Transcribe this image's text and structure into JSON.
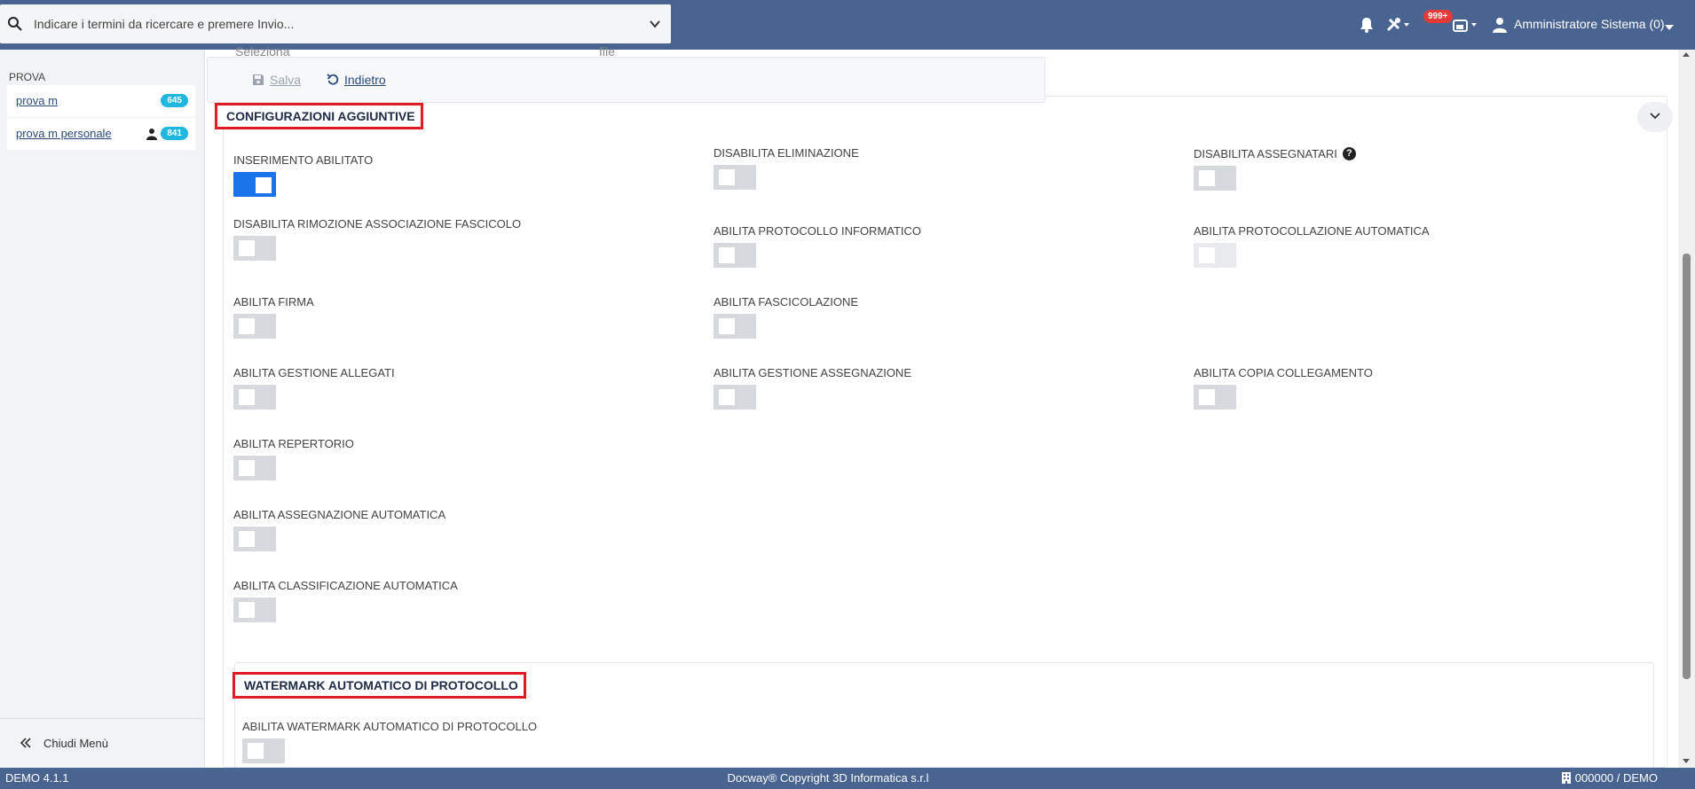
{
  "header": {
    "search_placeholder": "Indicare i termini da ricercare e premere Invio...",
    "notification_badge": "999+",
    "user_name": "Amministratore Sistema (0)"
  },
  "sidebar": {
    "section_title": "PROVA",
    "items": [
      {
        "label": "prova m",
        "count": "645"
      },
      {
        "label": "prova m personale",
        "count": "841"
      }
    ],
    "close_label": "Chiudi Menù"
  },
  "main": {
    "ghost_select_1": "Seleziona",
    "ghost_select_2": "file",
    "toolbar": {
      "save_label": "Salva",
      "back_label": "Indietro"
    },
    "section_title": "CONFIGURAZIONI AGGIUNTIVE",
    "fields": {
      "inserimento_abilitato": {
        "label": "INSERIMENTO ABILITATO",
        "on": true
      },
      "disabilita_eliminazione": {
        "label": "DISABILITA ELIMINAZIONE",
        "on": false
      },
      "disabilita_assegnatari": {
        "label": "DISABILITA ASSEGNATARI",
        "on": false
      },
      "disabilita_rimozione": {
        "label": "DISABILITA RIMOZIONE ASSOCIAZIONE FASCICOLO",
        "on": false
      },
      "abilita_protocollo_informatico": {
        "label": "ABILITA PROTOCOLLO INFORMATICO",
        "on": false
      },
      "abilita_protocollazione_automatica": {
        "label": "ABILITA PROTOCOLLAZIONE AUTOMATICA",
        "on": false,
        "disabled": true
      },
      "abilita_firma": {
        "label": "ABILITA FIRMA",
        "on": false
      },
      "abilita_fascicolazione": {
        "label": "ABILITA FASCICOLAZIONE",
        "on": false
      },
      "abilita_gestione_allegati": {
        "label": "ABILITA GESTIONE ALLEGATI",
        "on": false
      },
      "abilita_gestione_assegnazione": {
        "label": "ABILITA GESTIONE ASSEGNAZIONE",
        "on": false
      },
      "abilita_copia_collegamento": {
        "label": "ABILITA COPIA COLLEGAMENTO",
        "on": false
      },
      "abilita_repertorio": {
        "label": "ABILITA REPERTORIO",
        "on": false
      },
      "abilita_assegnazione_automatica": {
        "label": "ABILITA ASSEGNAZIONE AUTOMATICA",
        "on": false
      },
      "abilita_classificazione_automatica": {
        "label": "ABILITA CLASSIFICAZIONE AUTOMATICA",
        "on": false
      }
    },
    "watermark": {
      "title": "WATERMARK AUTOMATICO DI PROTOCOLLO",
      "field_label": "ABILITA WATERMARK AUTOMATICO DI PROTOCOLLO",
      "on": false
    }
  },
  "footer": {
    "version": "DEMO 4.1.1",
    "copyright": "Docway® Copyright 3D Informatica s.r.l",
    "office": "000000 / DEMO"
  },
  "colors": {
    "header_bg": "#4a6492",
    "toggle_on": "#1a73e8",
    "highlight_border": "#e21b24",
    "count_badge": "#1fb6e0"
  }
}
